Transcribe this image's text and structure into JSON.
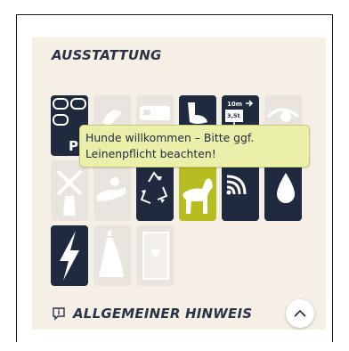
{
  "section": {
    "title": "AUSSTATTUNG"
  },
  "tooltip": {
    "text": "Hunde willkommen – Bitte ggf. Leinenpflicht beachten!"
  },
  "tiles": [
    {
      "icon": "parking-icon",
      "state": "active",
      "label": "P"
    },
    {
      "icon": "shower-icon",
      "state": "inactive"
    },
    {
      "icon": "caravan-icon",
      "state": "inactive"
    },
    {
      "icon": "toilet-icon",
      "state": "active"
    },
    {
      "icon": "vehicle-restriction-icon",
      "state": "active",
      "length_label": "10m",
      "weight_label": "3,5t"
    },
    {
      "icon": "view-icon",
      "state": "inactive"
    },
    {
      "icon": "windmill-icon",
      "state": "inactive"
    },
    {
      "icon": "service-icon",
      "state": "inactive"
    },
    {
      "icon": "recycling-icon",
      "state": "active"
    },
    {
      "icon": "dog-icon",
      "state": "highlighted"
    },
    {
      "icon": "wifi-icon",
      "state": "active"
    },
    {
      "icon": "water-icon",
      "state": "active"
    },
    {
      "icon": "electricity-icon",
      "state": "active"
    },
    {
      "icon": "bottle-icon",
      "state": "inactive"
    },
    {
      "icon": "brochure-icon",
      "state": "inactive"
    }
  ],
  "hint": {
    "title": "ALLGEMEINER HINWEIS"
  },
  "colors": {
    "dark": "#1f2a3e",
    "highlight": "#b6bd21",
    "panel": "#f5efe6",
    "tooltip": "#eaefaa"
  }
}
